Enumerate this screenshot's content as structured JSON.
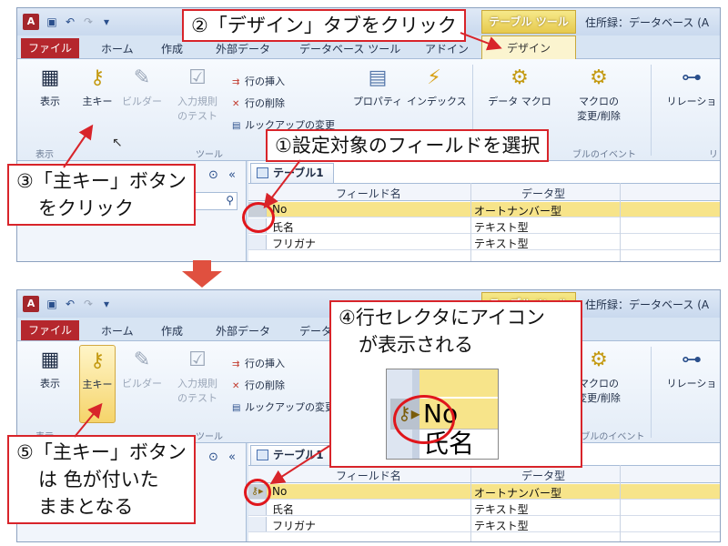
{
  "app": {
    "app_icon": "A",
    "context_tab_header": "テーブル ツール",
    "window_title_top": "住所録：データベース (A",
    "window_title_bottom": "住所録：データベース (A"
  },
  "tabs": {
    "file": "ファイル",
    "home": "ホーム",
    "create": "作成",
    "external": "外部データ",
    "dbtools": "データベース ツール",
    "addin": "アドイン",
    "design": "デザイン"
  },
  "ribbon": {
    "view": "表示",
    "primary_key": "主キー",
    "builder": "ビルダー",
    "test_rules_1": "入力規則",
    "test_rules_2": "のテスト",
    "insert_rows": "行の挿入",
    "delete_rows": "行の削除",
    "lookup": "ルックアップの変更",
    "property": "プロパティ",
    "index": "インデックス",
    "data_macro": "データ マクロ",
    "macro_1": "マクロの",
    "macro_2": "変更/削除",
    "relation": "リレーショ",
    "group_view": "表示",
    "group_tools": "ツール",
    "group_events": "ブルのイベント",
    "group_events_full": "テーブルのイベント",
    "group_rel": "リ"
  },
  "table": {
    "tab_label": "テーブル1",
    "col_field": "フィールド名",
    "col_type": "データ型",
    "rows": [
      {
        "field": "No",
        "type": "オートナンバー型"
      },
      {
        "field": "氏名",
        "type": "テキスト型"
      },
      {
        "field": "フリガナ",
        "type": "テキスト型"
      }
    ]
  },
  "callouts": {
    "c1": "①設定対象のフィールドを選択",
    "c2": "②「デザイン」タブをクリック",
    "c3_line1": "③「主キー」ボタン",
    "c3_line2": "をクリック",
    "c4_line1": "④行セレクタにアイコン",
    "c4_line2": "が表示される",
    "c5_line1": "⑤「主キー」ボタン",
    "c5_line2": "は 色が付いた",
    "c5_line3": "ままとなる"
  },
  "zoom": {
    "field1": "No",
    "field2": "氏名"
  },
  "colors": {
    "callout_border": "#d8242a",
    "file_tab": "#b5272d",
    "selected_row": "#f7e48a",
    "context_tab": "#e6c94e"
  }
}
